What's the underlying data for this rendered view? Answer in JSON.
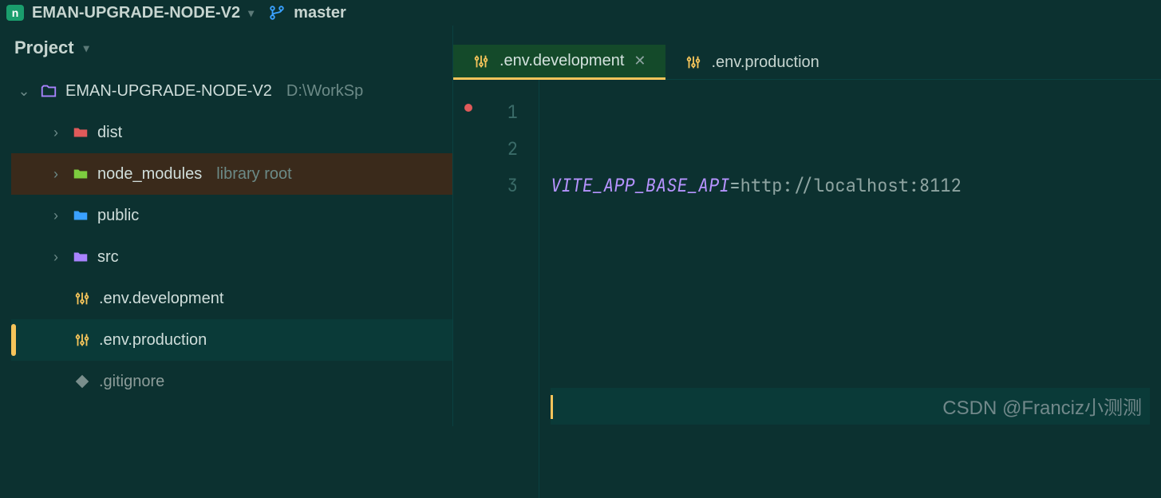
{
  "header": {
    "project_name": "EMAN-UPGRADE-NODE-V2",
    "branch": "master"
  },
  "sidebar": {
    "title": "Project",
    "root": {
      "name": "EMAN-UPGRADE-NODE-V2",
      "path_hint": "D:\\WorkSp"
    },
    "items": [
      {
        "name": "dist",
        "kind": "folder-red"
      },
      {
        "name": "node_modules",
        "aux": "library root",
        "kind": "folder-green",
        "selectedBrown": true
      },
      {
        "name": "public",
        "kind": "folder-blue"
      },
      {
        "name": "src",
        "kind": "folder-purple"
      },
      {
        "name": ".env.development",
        "kind": "sliders"
      },
      {
        "name": ".env.production",
        "kind": "sliders",
        "selected": true
      },
      {
        "name": ".gitignore",
        "kind": "diamond",
        "dim": true
      }
    ]
  },
  "editor": {
    "tabs": [
      {
        "label": ".env.development",
        "icon": "sliders",
        "active": true,
        "closable": true
      },
      {
        "label": ".env.production",
        "icon": "sliders",
        "active": false
      }
    ],
    "lines": {
      "1": {
        "var": "VITE_APP_BASE_API",
        "eq": "=",
        "val": "http://localhost:8112"
      },
      "2": "",
      "3": ""
    },
    "gutter": [
      "1",
      "2",
      "3"
    ],
    "cursor_line": 3,
    "modified": true
  },
  "watermark": "CSDN @Franciz小测测"
}
